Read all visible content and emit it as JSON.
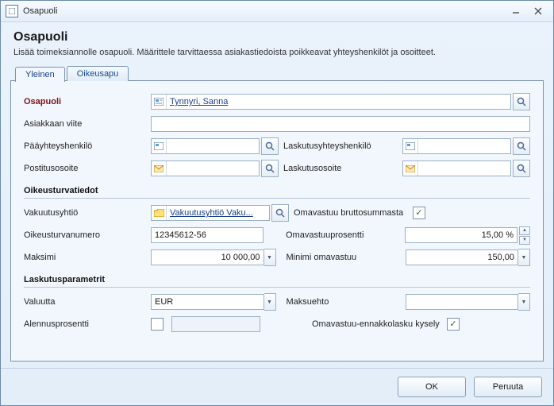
{
  "window": {
    "title": "Osapuoli"
  },
  "header": {
    "title": "Osapuoli",
    "subtitle": "Lisää toimeksiannolle osapuoli. Määrittele tarvittaessa asiakastiedoista poikkeavat yhteyshenkilöt ja osoitteet."
  },
  "tabs": {
    "general": "Yleinen",
    "legal_aid": "Oikeusapu"
  },
  "labels": {
    "osapuoli": "Osapuoli",
    "asiakkaan_viite": "Asiakkaan viite",
    "paayhteyshenkilo": "Pääyhteyshenkilö",
    "laskutusyhteyshenkilo": "Laskutusyhteyshenkilö",
    "postitusosoite": "Postitusosoite",
    "laskutusosoite": "Laskutusosoite",
    "oikeusturvatiedot": "Oikeusturvatiedot",
    "vakuutusyhtio": "Vakuutusyhtiö",
    "omavastuu_brutto": "Omavastuu bruttosummasta",
    "oikeusturvanumero": "Oikeusturvanumero",
    "omavastuuprosentti": "Omavastuuprosentti",
    "maksimi": "Maksimi",
    "minimi_omavastuu": "Minimi omavastuu",
    "laskutusparametrit": "Laskutusparametrit",
    "valuutta": "Valuutta",
    "maksuehto": "Maksuehto",
    "alennusprosentti": "Alennusprosentti",
    "omavastuu_ennakko": "Omavastuu-ennakkolasku kysely"
  },
  "values": {
    "osapuoli": "Tynnyri, Sanna",
    "asiakkaan_viite": "",
    "paayhteyshenkilo": "",
    "laskutusyhteyshenkilo": "",
    "postitusosoite": "",
    "laskutusosoite": "",
    "vakuutusyhtio": "Vakuutusyhtiö Vaku...",
    "omavastuu_brutto": true,
    "oikeusturvanumero": "12345612-56",
    "omavastuuprosentti": "15,00 %",
    "maksimi": "10 000,00",
    "minimi_omavastuu": "150,00",
    "valuutta": "EUR",
    "maksuehto": "",
    "alennus_checked": false,
    "alennusprosentti": "",
    "omavastuu_ennakko": true
  },
  "buttons": {
    "ok": "OK",
    "cancel": "Peruuta"
  }
}
